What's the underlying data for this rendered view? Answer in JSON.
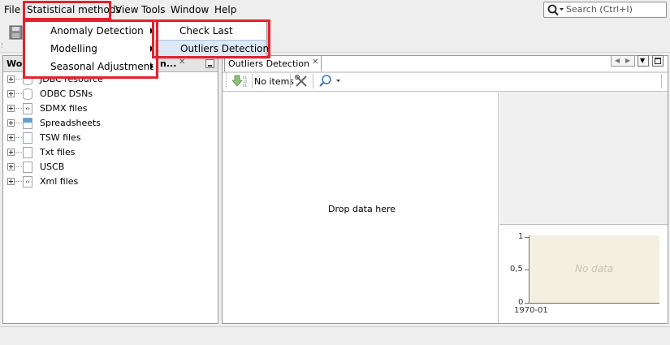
{
  "menubar": {
    "items": [
      "File",
      "Statistical methods",
      "View",
      "Tools",
      "Window",
      "Help"
    ],
    "search_placeholder": "Search (Ctrl+I)"
  },
  "left_panel": {
    "tab_title": "Wo",
    "tab_title_2": "n...",
    "tree": [
      {
        "label": "JDBC resource",
        "icon": "database-icon"
      },
      {
        "label": "ODBC DSNs",
        "icon": "database-icon"
      },
      {
        "label": "SDMX files",
        "icon": "xml-file-icon"
      },
      {
        "label": "Spreadsheets",
        "icon": "spreadsheet-icon"
      },
      {
        "label": "TSW files",
        "icon": "text-file-icon"
      },
      {
        "label": "Txt files",
        "icon": "text-file-icon"
      },
      {
        "label": "USCB",
        "icon": "text-file-icon"
      },
      {
        "label": "Xml files",
        "icon": "xml-file-icon"
      }
    ]
  },
  "center_panel": {
    "tab_title": "Outliers Detection",
    "no_items": "No items",
    "drop_text": "Drop data here",
    "chart": {
      "y_ticks": [
        "1",
        "0,5",
        "0"
      ],
      "x_tick": "1970-01",
      "placeholder": "No data",
      "background": "#f3f0e1"
    }
  },
  "stat_menu": {
    "items": [
      "Anomaly Detection",
      "Modelling",
      "Seasonal Adjustment"
    ]
  },
  "anomaly_submenu": {
    "items": [
      "Check Last",
      "Outliers Detection"
    ],
    "highlighted": "Outliers Detection"
  },
  "colors": {
    "annotation_red": "#e2232f",
    "highlight": "#dde8f6"
  }
}
